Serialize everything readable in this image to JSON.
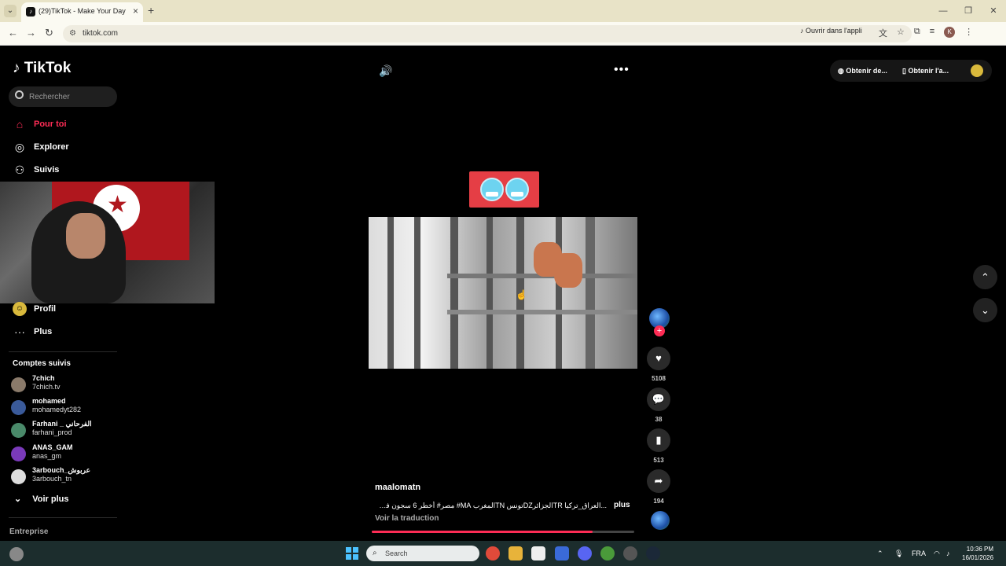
{
  "browser": {
    "tab_title": "(29)TikTok - Make Your Day",
    "url": "tiktok.com",
    "open_in_app": "Ouvrir dans l'appli",
    "window_controls": [
      "—",
      "❐",
      "✕"
    ]
  },
  "tiktok": {
    "logo": "TikTok",
    "search_placeholder": "Rechercher",
    "nav": {
      "for_you": "Pour toi",
      "explore": "Explorer",
      "following": "Suivis",
      "profile": "Profil",
      "more": "Plus"
    },
    "followed_title": "Comptes suivis",
    "followed": [
      {
        "name": "7chich",
        "handle": "7chich.tv",
        "color": "#8a7a6a"
      },
      {
        "name": "mohamed",
        "handle": "mohamedyt282",
        "color": "#3a5a9a"
      },
      {
        "name": "Farhani _ الفرحاني",
        "handle": "farhani_prod",
        "color": "#4a8a6a"
      },
      {
        "name": "ANAS_GAM",
        "handle": "anas_gm",
        "color": "#7a3aba"
      },
      {
        "name": "3arbouch_عربوش",
        "handle": "3arbouch_tn",
        "color": "#dddddd"
      }
    ],
    "see_more": "Voir plus",
    "entreprise": "Entreprise",
    "top_right": {
      "get_desktop": "Obtenir de...",
      "get_app": "Obtenir l'a..."
    }
  },
  "video": {
    "author": "maalomatn",
    "description": "...العراق_تركيا TRالجزائرDZتونس TNالمغرب MA# مصر# أخطر 6 سجون في تونس",
    "more_label": "plus",
    "translate": "Voir la traduction",
    "progress": 0.84,
    "likes": "5108",
    "comments": "38",
    "saves": "513",
    "shares": "194"
  },
  "taskbar": {
    "search": "Search",
    "lang": "FRA",
    "time": "10:36 PM",
    "date": "16/01/2026"
  },
  "colors": {
    "accent": "#fe2c55",
    "emoji_box": "#e53e45"
  }
}
